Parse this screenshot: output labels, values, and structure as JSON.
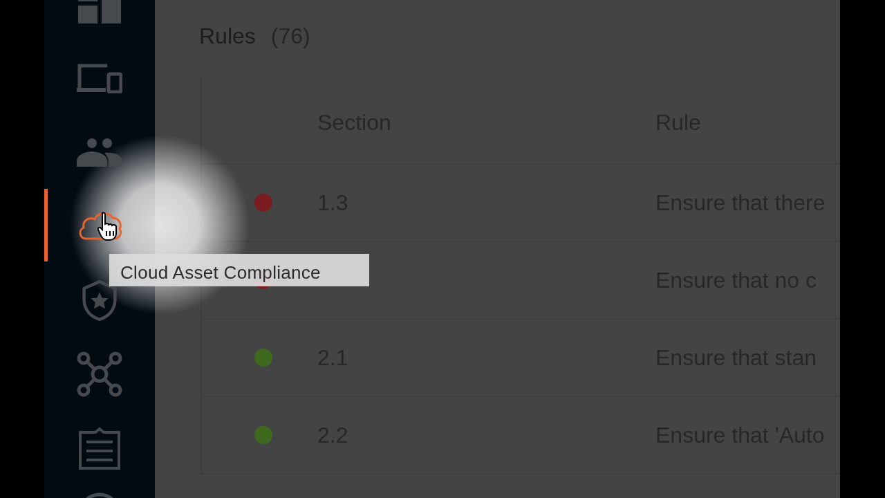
{
  "sidebar": {
    "items": [
      {
        "kind": "grid",
        "selected": false
      },
      {
        "kind": "devices",
        "selected": false
      },
      {
        "kind": "people",
        "selected": false
      },
      {
        "kind": "cloud",
        "selected": true
      },
      {
        "kind": "shield",
        "selected": false
      },
      {
        "kind": "network",
        "selected": false
      },
      {
        "kind": "clipboard",
        "selected": false
      },
      {
        "kind": "round",
        "selected": false
      }
    ]
  },
  "tooltip": "Cloud Asset Compliance",
  "page": {
    "title": "Rules",
    "count": "(76)"
  },
  "table": {
    "columns": [
      "Section",
      "Rule"
    ],
    "rows": [
      {
        "color": "#7a1c20",
        "section": "1.3",
        "rule": "Ensure that there"
      },
      {
        "color": "#7a1c20",
        "rule": "Ensure that no c"
      },
      {
        "color": "#3f6a1e",
        "section": "2.1",
        "rule": "Ensure that stan"
      },
      {
        "color": "#3f6a1e",
        "section": "2.2",
        "rule": "Ensure that 'Auto"
      }
    ]
  }
}
